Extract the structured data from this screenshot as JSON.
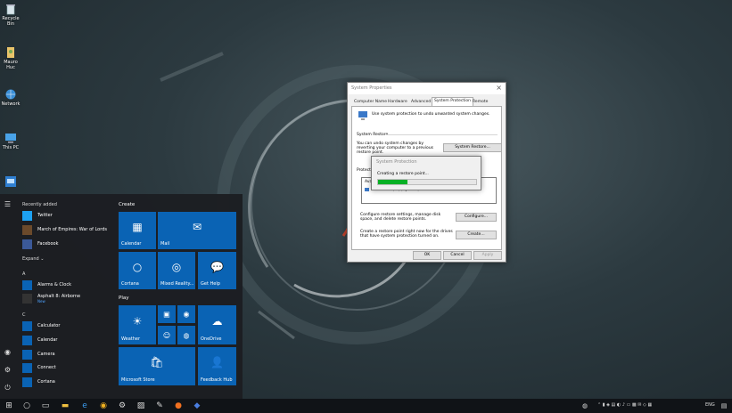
{
  "desktop": {
    "icons": [
      {
        "label": "Recycle Bin",
        "icon": "recycle-bin-icon"
      },
      {
        "label": "Mauro Huc",
        "icon": "user-folder-icon"
      },
      {
        "label": "Network",
        "icon": "network-icon"
      },
      {
        "label": "This PC",
        "icon": "this-pc-icon"
      },
      {
        "label": "",
        "icon": "control-panel-icon"
      }
    ]
  },
  "start_menu": {
    "recently_added_label": "Recently added",
    "recent": [
      "Twitter",
      "March of Empires: War of Lords",
      "Facebook"
    ],
    "expand_label": "Expand",
    "letter_a": "A",
    "a_apps": [
      {
        "label": "Alarms & Clock",
        "sub": ""
      },
      {
        "label": "Asphalt 8: Airborne",
        "sub": "New"
      }
    ],
    "letter_c": "C",
    "c_apps": [
      "Calculator",
      "Calendar",
      "Camera",
      "Connect",
      "Cortana"
    ],
    "create_label": "Create",
    "play_label": "Play",
    "create_tiles": [
      "Calendar",
      "Mail",
      "Cortana",
      "Mixed Reality...",
      "Get Help"
    ],
    "play_tiles": [
      "Weather",
      "OneDrive",
      "Microsoft Store",
      "Feedback Hub"
    ],
    "tile_color": "#0a63b4"
  },
  "system_properties": {
    "title": "System Properties",
    "tabs": [
      "Computer Name",
      "Hardware",
      "Advanced",
      "System Protection",
      "Remote"
    ],
    "active_tab": "System Protection",
    "intro": "Use system protection to undo unwanted system changes.",
    "restore_section": "System Restore",
    "restore_text": "You can undo system changes by reverting your computer to a previous restore point.",
    "restore_button": "System Restore...",
    "protection_section": "Protection",
    "list_col_avail": "Avail",
    "drive_label": "Local Disk (C:) (System)",
    "drive_status": "On",
    "configure_text": "Configure restore settings, manage disk space, and delete restore points.",
    "configure_button": "Configure...",
    "create_text": "Create a restore point right now for the drives that have system protection turned on.",
    "create_button": "Create...",
    "ok": "OK",
    "cancel": "Cancel",
    "apply": "Apply"
  },
  "restore_popup": {
    "title": "System Protection",
    "message": "Creating a restore point...",
    "progress": 0.3,
    "bar_color": "#06b025"
  },
  "taskbar": {
    "language": "ENG",
    "icons": [
      "windows-start-icon",
      "search-icon",
      "task-view-icon",
      "file-explorer-icon",
      "edge-icon",
      "mail-icon",
      "settings-icon",
      "photos-icon",
      "notes-icon",
      "firefox-icon",
      "app-icon"
    ]
  }
}
